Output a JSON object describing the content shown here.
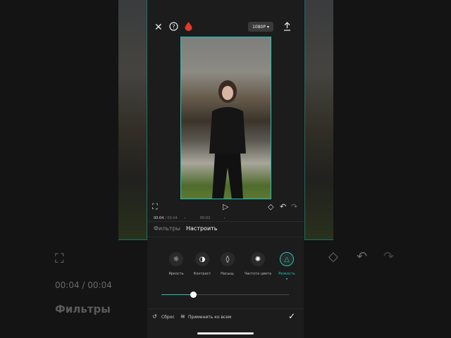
{
  "top_bar": {
    "resolution_label": "1080P ▾"
  },
  "player": {
    "current_time": "00:04",
    "separator": "/",
    "total_time": "00:04",
    "tick_label": "00:02"
  },
  "tabs": [
    {
      "label": "Фильтры",
      "active": false
    },
    {
      "label": "Настроить",
      "active": true
    }
  ],
  "adjust_tools": [
    {
      "label": "Яркость",
      "icon": "sun-icon",
      "active": false
    },
    {
      "label": "Контраст",
      "icon": "contrast-icon",
      "active": false
    },
    {
      "label": "Насыщ.",
      "icon": "drop-icon",
      "active": false
    },
    {
      "label": "Частота цвета",
      "icon": "color-temp-icon",
      "active": false
    },
    {
      "label": "Резкость",
      "icon": "triangle-icon",
      "active": true
    }
  ],
  "slider": {
    "value": 0.25
  },
  "bottom_bar": {
    "reset_label": "Сброс",
    "apply_all_label": "Применить ко всем"
  },
  "background": {
    "time_current": "00:04",
    "time_separator": "/",
    "time_total": "00:04",
    "filters_label": "Фильтры"
  },
  "colors": {
    "accent": "#1fc6b5",
    "panel": "#1c1c1c",
    "record_red": "#e23a2e"
  }
}
